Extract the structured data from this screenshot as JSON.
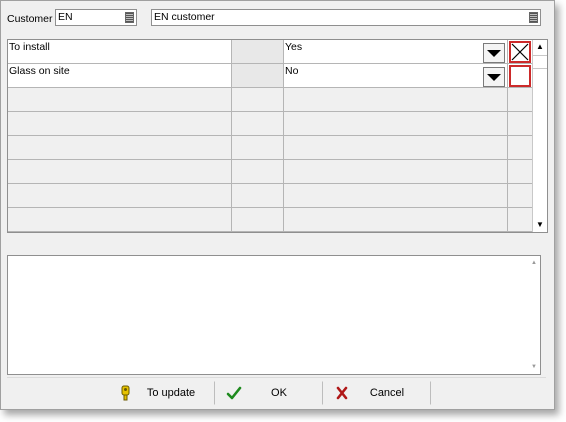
{
  "header": {
    "customer_label": "Customer",
    "customer_code": "EN",
    "customer_name": "EN customer"
  },
  "grid": {
    "rows": [
      {
        "item": "To install",
        "extra": "",
        "value": "Yes",
        "checked": true
      },
      {
        "item": "Glass on site",
        "extra": "",
        "value": "No",
        "checked": false
      }
    ],
    "empty_rows": 6,
    "scroll_up_glyph": "▲",
    "scroll_down_glyph": "▼"
  },
  "notes": {
    "text": ""
  },
  "buttons": {
    "update_label": "To update",
    "ok_label": "OK",
    "cancel_label": "Cancel"
  },
  "icons": {
    "update": "key-icon",
    "ok": "checkmark-icon",
    "cancel": "close-x-icon"
  },
  "colors": {
    "ok_icon": "#1e8a1e",
    "cancel_icon": "#b01818",
    "update_icon": "#d4b400",
    "selected_cell_border": "#cc2a2a"
  }
}
